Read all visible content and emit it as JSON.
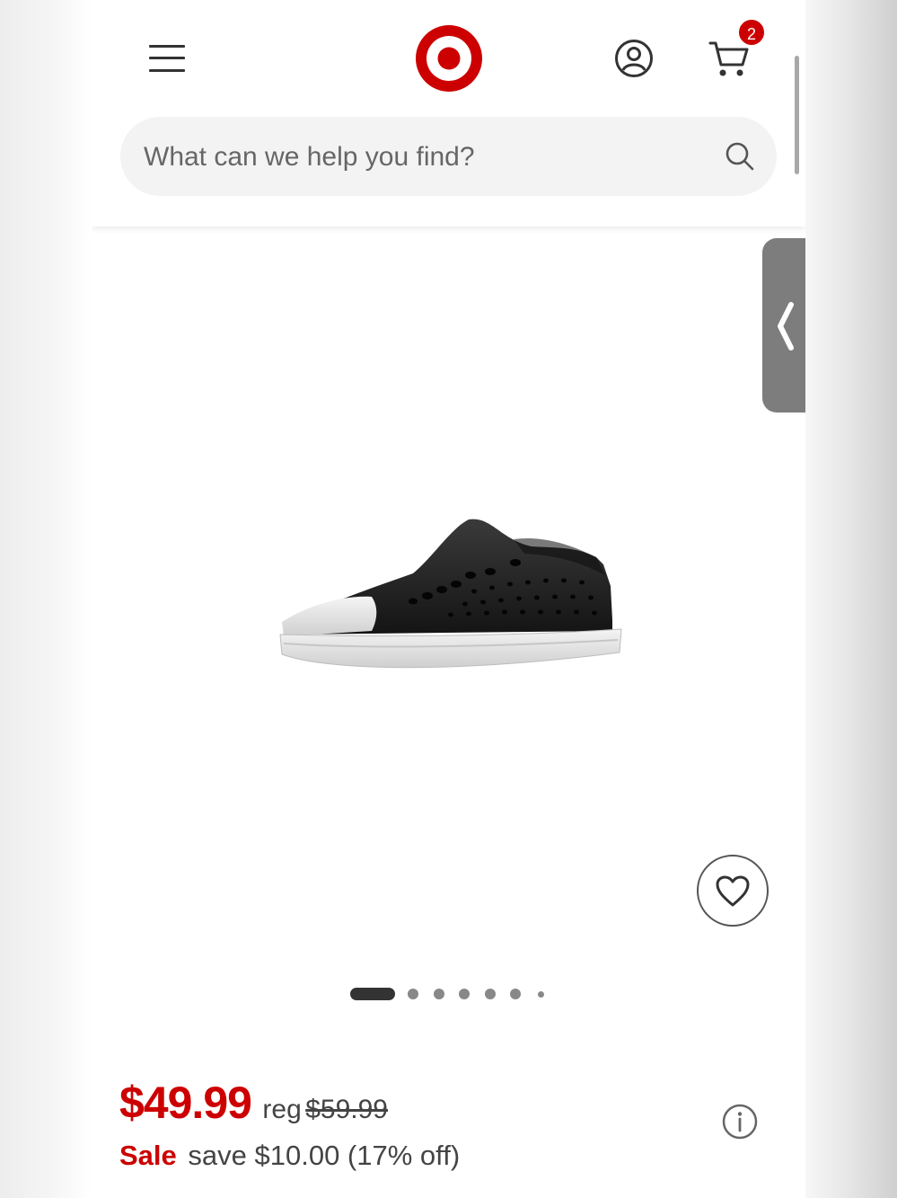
{
  "header": {
    "cart_count": "2",
    "search": {
      "placeholder": "What can we help you find?"
    }
  },
  "product": {
    "price": "$49.99",
    "reg_label": "reg",
    "reg_price": "$59.99",
    "sale_label": "Sale",
    "save_text": "save $10.00 (17% off)",
    "image_count": 7,
    "active_image_index": 0
  },
  "icons": {
    "menu": "hamburger-icon",
    "logo": "target-bullseye-logo",
    "account": "account-icon",
    "cart": "cart-icon",
    "search": "search-icon",
    "side_tab": "chevron-left-icon",
    "favorite": "heart-icon",
    "info": "info-icon"
  },
  "colors": {
    "brand_red": "#cc0000",
    "text": "#444444",
    "search_bg": "#f3f3f3"
  }
}
